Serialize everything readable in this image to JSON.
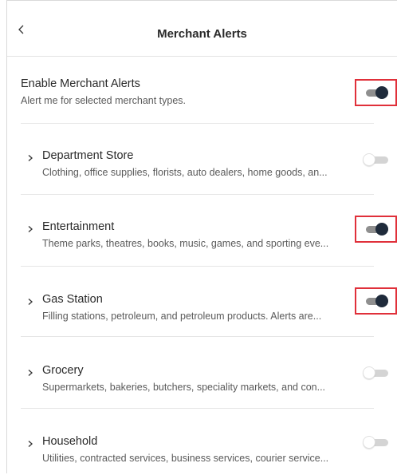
{
  "header": {
    "title": "Merchant Alerts",
    "back_icon": "chevron-left-icon"
  },
  "master": {
    "title": "Enable Merchant Alerts",
    "subtitle": "Alert me for selected merchant types.",
    "enabled": true
  },
  "categories": [
    {
      "title": "Department Store",
      "subtitle": "Clothing, office supplies, florists, auto dealers, home goods, an...",
      "enabled": false
    },
    {
      "title": "Entertainment",
      "subtitle": "Theme parks, theatres, books, music, games, and sporting eve...",
      "enabled": true
    },
    {
      "title": "Gas Station",
      "subtitle": "Filling stations, petroleum, and petroleum products. Alerts are...",
      "enabled": true
    },
    {
      "title": "Grocery",
      "subtitle": "Supermarkets, bakeries, butchers, speciality markets, and con...",
      "enabled": false
    },
    {
      "title": "Household",
      "subtitle": "Utilities, contracted services, business services, courier service...",
      "enabled": false
    }
  ],
  "colors": {
    "toggle_on_knob": "#1f2b3b",
    "toggle_on_track": "#8f8f8f",
    "toggle_off_track": "#d4d4d4",
    "highlight_border": "#e0303a"
  }
}
